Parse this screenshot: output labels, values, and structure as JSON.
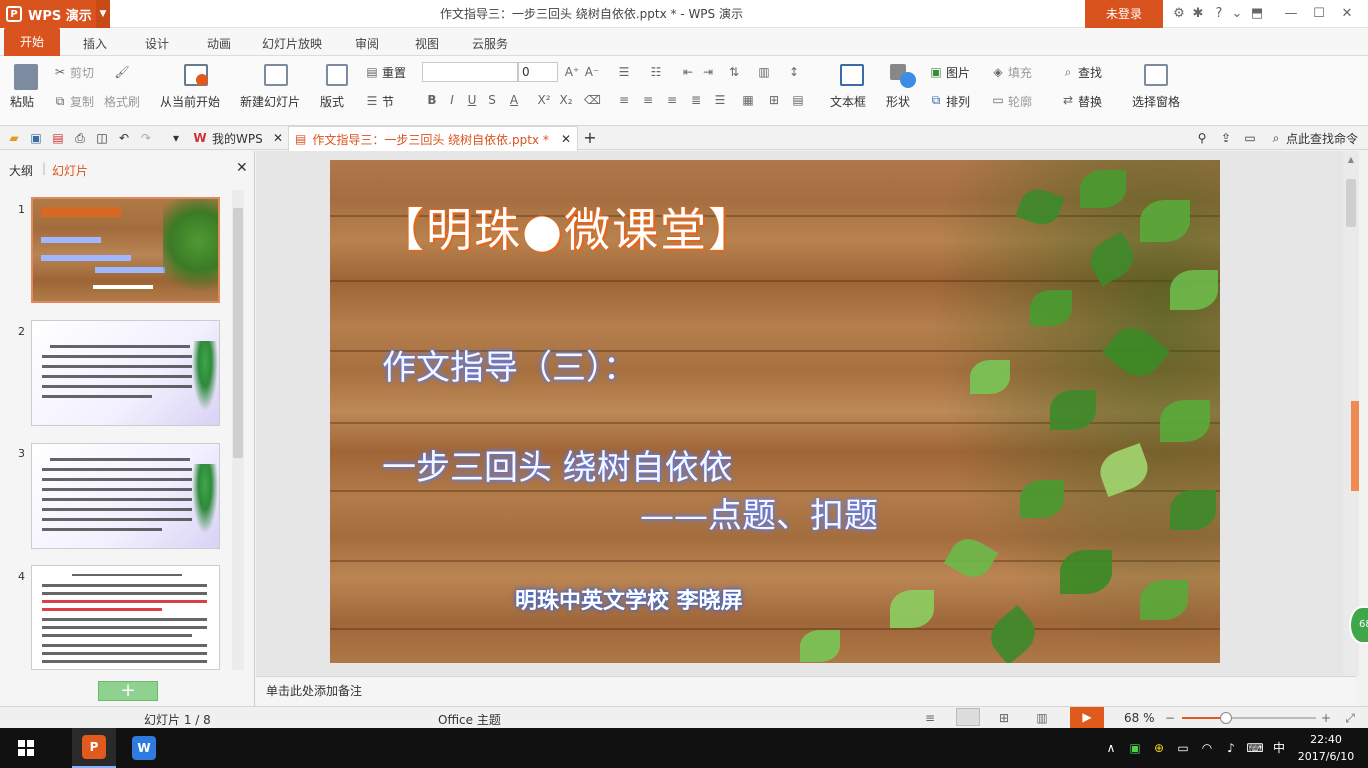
{
  "app": {
    "name": "WPS 演示",
    "window_title": "作文指导三：一步三回头 绕树自依依.pptx * - WPS 演示",
    "login_label": "未登录",
    "accent_color": "#d9531e"
  },
  "menu": {
    "tabs": [
      "开始",
      "插入",
      "设计",
      "动画",
      "幻灯片放映",
      "审阅",
      "视图",
      "云服务"
    ],
    "active": "开始"
  },
  "ribbon": {
    "paste": "粘贴",
    "cut": "剪切",
    "copy": "复制",
    "format_painter": "格式刷",
    "from_current": "从当前开始",
    "new_slide": "新建幻灯片",
    "layout": "版式",
    "reset": "重置",
    "section": "节",
    "font_size": "0",
    "text_box": "文本框",
    "shape": "形状",
    "picture": "图片",
    "fill": "填充",
    "arrange": "排列",
    "outline": "轮廓",
    "find": "查找",
    "replace": "替换",
    "selection_pane": "选择窗格"
  },
  "qabar": {
    "my_wps": "我的WPS",
    "doc_tab": "作文指导三：一步三回头 绕树自依依.pptx *",
    "search_command": "点此查找命令"
  },
  "left_pane": {
    "tab_outline": "大纲",
    "tab_slides": "幻灯片",
    "slide_numbers": [
      "1",
      "2",
      "3",
      "4"
    ]
  },
  "slide": {
    "title": "【明珠●微课堂】",
    "subtitle1": "作文指导（三）：",
    "subtitle2": "一步三回头 绕树自依依",
    "subtitle3": "——点题、扣题",
    "author": "明珠中英文学校 李晓屏"
  },
  "notes_placeholder": "单击此处添加备注",
  "status": {
    "slide_counter": "幻灯片 1 / 8",
    "theme": "Office 主题",
    "zoom": "68 %",
    "zoom_fraction": 0.33,
    "side_badge": "68"
  },
  "taskbar": {
    "time": "22:40",
    "date": "2017/6/10",
    "ime": "中"
  }
}
